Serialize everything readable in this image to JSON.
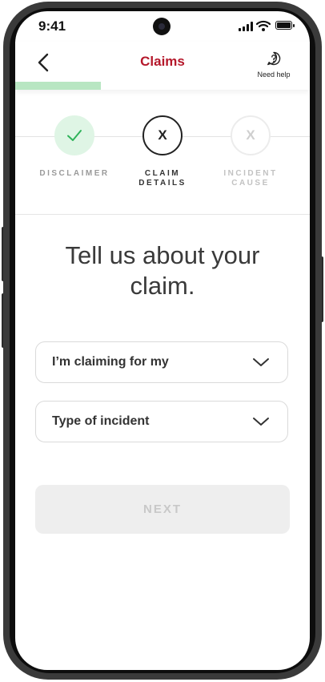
{
  "status_bar": {
    "time": "9:41"
  },
  "header": {
    "title": "Claims",
    "back_icon": "chevron-left-icon",
    "help_icon": "question-circle-icon",
    "help_label": "Need help",
    "progress": 0.29
  },
  "stepper": {
    "steps": [
      {
        "label_line1": "DISCLAIMER",
        "label_line2": "",
        "state": "done",
        "glyph": "✓"
      },
      {
        "label_line1": "CLAIM",
        "label_line2": "DETAILS",
        "state": "active",
        "glyph": "X"
      },
      {
        "label_line1": "INCIDENT",
        "label_line2": "CAUSE",
        "state": "inactive",
        "glyph": "X"
      }
    ]
  },
  "heading": {
    "line1": "Tell us about your",
    "line2": "claim."
  },
  "form": {
    "claiming_for": "I’m claiming for my",
    "incident_type": "Type of incident"
  },
  "next_button": {
    "label": "NEXT",
    "enabled": false
  },
  "colors": {
    "brand": "#b5182b",
    "success": "#b8e6c2",
    "done_fill": "#dff5e5",
    "check": "#2fb35a"
  }
}
